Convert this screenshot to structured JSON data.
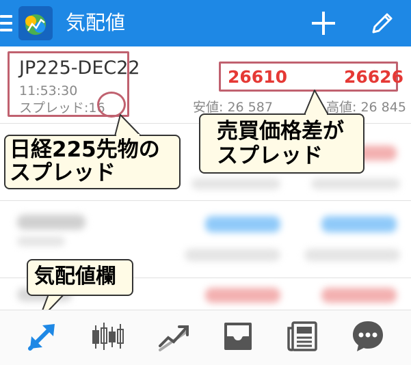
{
  "header": {
    "title": "気配値",
    "menu_icon": "hamburger-menu-icon",
    "logo_icon": "metatrader-logo-icon",
    "add_icon": "plus-icon",
    "edit_icon": "pencil-icon"
  },
  "quote": {
    "symbol": "JP225-DEC22",
    "time": "11:53:30",
    "spread_label": "スプレッド:",
    "spread_value": "16",
    "bid": "26610",
    "ask": "26626",
    "low_label": "安値:",
    "low_value": "26 587",
    "high_label": "高値:",
    "high_value": "26 845"
  },
  "callouts": {
    "left_line1": "日経225先物の",
    "left_line2": "スプレッド",
    "right_line1": "売買価格差が",
    "right_line2": "スプレッド",
    "bottom": "気配値欄"
  },
  "nav": {
    "items": [
      "quotes-icon",
      "chart-icon",
      "trade-icon",
      "history-icon",
      "news-icon",
      "chat-icon"
    ]
  },
  "colors": {
    "header_bg": "#1e88e5",
    "price_red": "#e53935",
    "highlight": "#c0616f",
    "callout_bg": "#fffbe6"
  }
}
